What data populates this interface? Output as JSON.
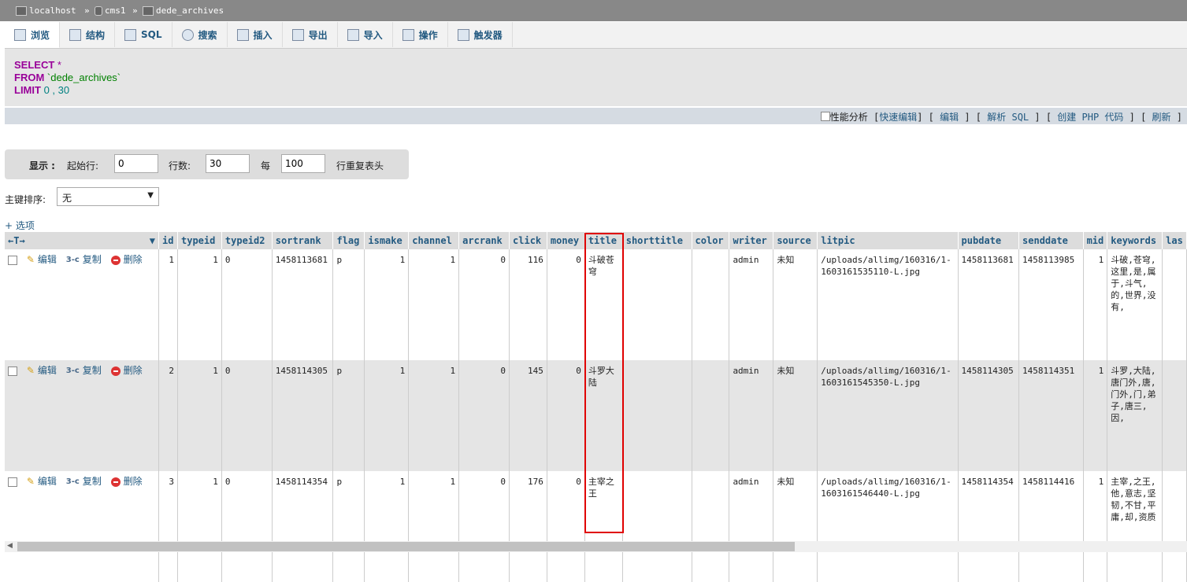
{
  "breadcrumb": {
    "server": "localhost",
    "database": "cms1",
    "table": "dede_archives",
    "sep": "»"
  },
  "tabs": [
    {
      "label": "浏览",
      "icon": "browse-icon"
    },
    {
      "label": "结构",
      "icon": "structure-icon"
    },
    {
      "label": "SQL",
      "icon": "sql-icon"
    },
    {
      "label": "搜索",
      "icon": "search-icon"
    },
    {
      "label": "插入",
      "icon": "insert-icon"
    },
    {
      "label": "导出",
      "icon": "export-icon"
    },
    {
      "label": "导入",
      "icon": "import-icon"
    },
    {
      "label": "操作",
      "icon": "wrench-icon"
    },
    {
      "label": "触发器",
      "icon": "trigger-icon"
    }
  ],
  "query": {
    "select": "SELECT",
    "star": "*",
    "from": "FROM",
    "table": "`dede_archives`",
    "limit": "LIMIT",
    "offset": "0",
    "comma": ",",
    "count": "30"
  },
  "sqlbar": {
    "profiling": "性能分析",
    "links": [
      "快速编辑",
      "编辑",
      "解析 SQL",
      "创建 PHP 代码",
      "刷新"
    ]
  },
  "display": {
    "label": "显示 :",
    "start_label": "起始行:",
    "start_value": "0",
    "rows_label": "行数:",
    "rows_value": "30",
    "every_label": "每",
    "every_value": "100",
    "repeat_label": "行重复表头"
  },
  "sort": {
    "label": "主键排序:",
    "value": "无"
  },
  "options_label": "+ 选项",
  "header_arrows": "←T→",
  "columns": [
    "id",
    "typeid",
    "typeid2",
    "sortrank",
    "flag",
    "ismake",
    "channel",
    "arcrank",
    "click",
    "money",
    "title",
    "shorttitle",
    "color",
    "writer",
    "source",
    "litpic",
    "pubdate",
    "senddate",
    "mid",
    "keywords",
    "las"
  ],
  "actions": {
    "edit": "编辑",
    "copy": "复制",
    "delete": "删除"
  },
  "rows": [
    {
      "id": "1",
      "typeid": "1",
      "typeid2": "0",
      "sortrank": "1458113681",
      "flag": "p",
      "ismake": "1",
      "channel": "1",
      "arcrank": "0",
      "click": "116",
      "money": "0",
      "title": "斗破苍穹",
      "shorttitle": "",
      "color": "",
      "writer": "admin",
      "source": "未知",
      "litpic": "/uploads/allimg/160316/1-1603161535110-L.jpg",
      "pubdate": "1458113681",
      "senddate": "1458113985",
      "mid": "1",
      "keywords": "斗破,苍穹,这里,是,属于,斗气,的,世界,没有,"
    },
    {
      "id": "2",
      "typeid": "1",
      "typeid2": "0",
      "sortrank": "1458114305",
      "flag": "p",
      "ismake": "1",
      "channel": "1",
      "arcrank": "0",
      "click": "145",
      "money": "0",
      "title": "斗罗大陆",
      "shorttitle": "",
      "color": "",
      "writer": "admin",
      "source": "未知",
      "litpic": "/uploads/allimg/160316/1-1603161545350-L.jpg",
      "pubdate": "1458114305",
      "senddate": "1458114351",
      "mid": "1",
      "keywords": "斗罗,大陆,唐门外,唐,门外,门,弟子,唐三,因,"
    },
    {
      "id": "3",
      "typeid": "1",
      "typeid2": "0",
      "sortrank": "1458114354",
      "flag": "p",
      "ismake": "1",
      "channel": "1",
      "arcrank": "0",
      "click": "176",
      "money": "0",
      "title": "主宰之王",
      "shorttitle": "",
      "color": "",
      "writer": "admin",
      "source": "未知",
      "litpic": "/uploads/allimg/160316/1-1603161546440-L.jpg",
      "pubdate": "1458114354",
      "senddate": "1458114416",
      "mid": "1",
      "keywords": "主宰,之王,他,意志,坚韧,不甘,平庸,却,资质"
    }
  ]
}
